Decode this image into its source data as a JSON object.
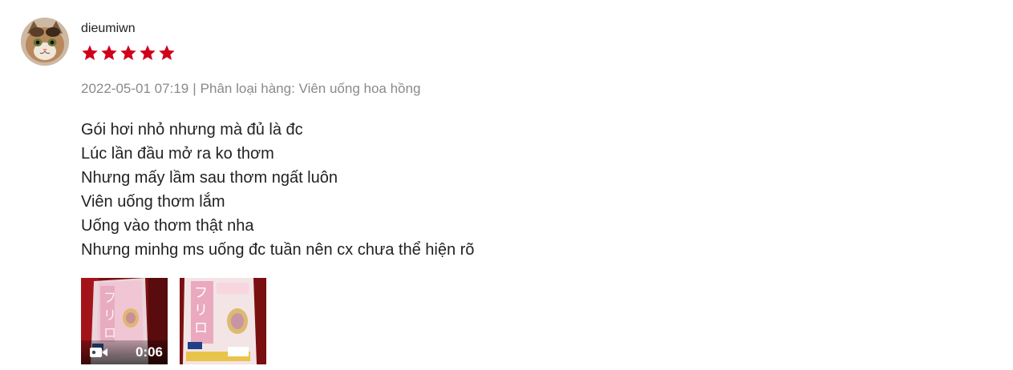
{
  "review": {
    "author": {
      "username": "dieumiwn",
      "avatar_icon": "cat-avatar-icon"
    },
    "rating": {
      "value": 5,
      "max": 5,
      "star_color": "#d0011b"
    },
    "timestamp": "2022-05-01 07:19",
    "separator": "|",
    "variation": "Phân loại hàng: Viên uống hoa hồng",
    "comment_lines": [
      "Gói hơi nhỏ nhưng mà đủ là đc",
      "Lúc lần đầu mở ra ko thơm",
      "Nhưng mấy lầm sau thơm ngất luôn",
      "Viên uống thơm lắm",
      "Uống vào thơm thật nha",
      "Nhưng minhg ms uống đc tuần nên cx chưa thể hiện rõ"
    ],
    "media": [
      {
        "type": "video",
        "duration": "0:06",
        "icon": "video-camera-icon"
      },
      {
        "type": "photo",
        "icon": "product-photo"
      }
    ]
  }
}
